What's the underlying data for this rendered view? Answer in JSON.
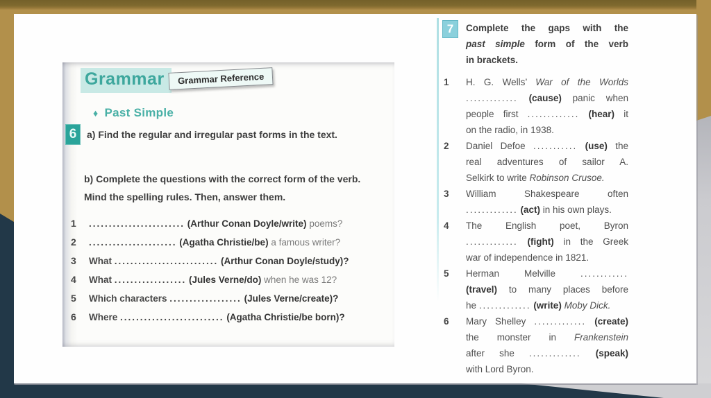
{
  "colors": {
    "gold": "#b2904b",
    "gold_dark": "#7f692e",
    "navy": "#223848",
    "gray_edge": "#cfcfd2",
    "teal_accent": "#3da79d",
    "badge6_bg": "#2aa49a",
    "badge7_bg": "#8bd0dc",
    "highlight_mint": "#c8e9e5"
  },
  "ex6": {
    "grammar_title": "Grammar",
    "grammar_ref_label": "Grammar Reference",
    "section_bullet": "♦",
    "section_title": "Past Simple",
    "badge": "6",
    "part_a": [
      {
        "t": "a) Find the regular and irregular past forms in the text."
      }
    ],
    "part_b": [
      {
        "t": "b) Complete the questions with the correct form of the verb. Mind the spelling rules. Then, answer them."
      }
    ],
    "questions": [
      {
        "num": "1",
        "segments": [
          {
            "t": "........................",
            "s": "d"
          },
          {
            "t": " "
          },
          {
            "t": "(Arthur Conan Doyle/write)",
            "s": "b"
          },
          {
            "t": " poems?",
            "s": "l"
          }
        ]
      },
      {
        "num": "2",
        "segments": [
          {
            "t": "......................",
            "s": "d"
          },
          {
            "t": " "
          },
          {
            "t": "(Agatha Christie/be)",
            "s": "b"
          },
          {
            "t": " a famous writer?",
            "s": "l"
          }
        ]
      },
      {
        "num": "3",
        "segments": [
          {
            "t": "What "
          },
          {
            "t": "..........................",
            "s": "d"
          },
          {
            "t": " "
          },
          {
            "t": "(Arthur Conan Doyle/study)?",
            "s": "b"
          }
        ]
      },
      {
        "num": "4",
        "segments": [
          {
            "t": "What "
          },
          {
            "t": "..................",
            "s": "d"
          },
          {
            "t": " "
          },
          {
            "t": "(Jules Verne/do)",
            "s": "b"
          },
          {
            "t": " when he was 12?",
            "s": "l"
          }
        ]
      },
      {
        "num": "5",
        "segments": [
          {
            "t": "Which characters "
          },
          {
            "t": "..................",
            "s": "d"
          },
          {
            "t": " "
          },
          {
            "t": "(Jules Verne/create)?",
            "s": "b"
          }
        ]
      },
      {
        "num": "6",
        "segments": [
          {
            "t": "Where "
          },
          {
            "t": "..........................",
            "s": "d"
          },
          {
            "t": " "
          },
          {
            "t": "(Agatha Christie/be born)?",
            "s": "b"
          }
        ]
      }
    ]
  },
  "ex7": {
    "badge": "7",
    "instruction_lines": [
      [
        {
          "t": "Complete the gaps with the"
        }
      ],
      [
        {
          "t": "past simple",
          "s": "bi"
        },
        {
          "t": " form of the verb"
        }
      ],
      [
        {
          "t": "in brackets."
        }
      ]
    ],
    "items": [
      {
        "num": "1",
        "lines": [
          [
            {
              "t": "H. G. Wells’ "
            },
            {
              "t": "War of the Worlds",
              "s": "i"
            }
          ],
          [
            {
              "t": ".............",
              "s": "d"
            },
            {
              "t": " "
            },
            {
              "t": "(cause)",
              "s": "b"
            },
            {
              "t": " panic when"
            }
          ],
          [
            {
              "t": "people first "
            },
            {
              "t": ".............",
              "s": "d"
            },
            {
              "t": " "
            },
            {
              "t": "(hear)",
              "s": "b"
            },
            {
              "t": " it"
            }
          ],
          [
            {
              "t": "on the radio, in 1938."
            }
          ]
        ]
      },
      {
        "num": "2",
        "lines": [
          [
            {
              "t": "Daniel Defoe "
            },
            {
              "t": "...........",
              "s": "d"
            },
            {
              "t": " "
            },
            {
              "t": "(use)",
              "s": "b"
            },
            {
              "t": " the"
            }
          ],
          [
            {
              "t": "real adventures of sailor A."
            }
          ],
          [
            {
              "t": "Selkirk to write "
            },
            {
              "t": "Robinson Crusoe.",
              "s": "i"
            }
          ]
        ]
      },
      {
        "num": "3",
        "lines": [
          [
            {
              "t": "William Shakespeare often"
            }
          ],
          [
            {
              "t": ".............",
              "s": "d"
            },
            {
              "t": " "
            },
            {
              "t": "(act)",
              "s": "b"
            },
            {
              "t": " in his own plays."
            }
          ]
        ]
      },
      {
        "num": "4",
        "lines": [
          [
            {
              "t": "The English poet, Byron"
            }
          ],
          [
            {
              "t": ".............",
              "s": "d"
            },
            {
              "t": " "
            },
            {
              "t": "(fight)",
              "s": "b"
            },
            {
              "t": " in the Greek"
            }
          ],
          [
            {
              "t": "war of independence in 1821."
            }
          ]
        ]
      },
      {
        "num": "5",
        "lines": [
          [
            {
              "t": "Herman Melville "
            },
            {
              "t": "............",
              "s": "d"
            }
          ],
          [
            {
              "t": "(travel)",
              "s": "b"
            },
            {
              "t": " to many places before"
            }
          ],
          [
            {
              "t": "he "
            },
            {
              "t": ".............",
              "s": "d"
            },
            {
              "t": " "
            },
            {
              "t": "(write)",
              "s": "b"
            },
            {
              "t": " "
            },
            {
              "t": "Moby Dick.",
              "s": "i"
            }
          ]
        ]
      },
      {
        "num": "6",
        "lines": [
          [
            {
              "t": "Mary Shelley "
            },
            {
              "t": ".............",
              "s": "d"
            },
            {
              "t": " "
            },
            {
              "t": "(create)",
              "s": "b"
            }
          ],
          [
            {
              "t": "the monster in "
            },
            {
              "t": "Frankenstein",
              "s": "i"
            }
          ],
          [
            {
              "t": "after she "
            },
            {
              "t": ".............",
              "s": "d"
            },
            {
              "t": " "
            },
            {
              "t": "(speak)",
              "s": "b"
            }
          ],
          [
            {
              "t": "with Lord Byron."
            }
          ]
        ]
      }
    ]
  }
}
